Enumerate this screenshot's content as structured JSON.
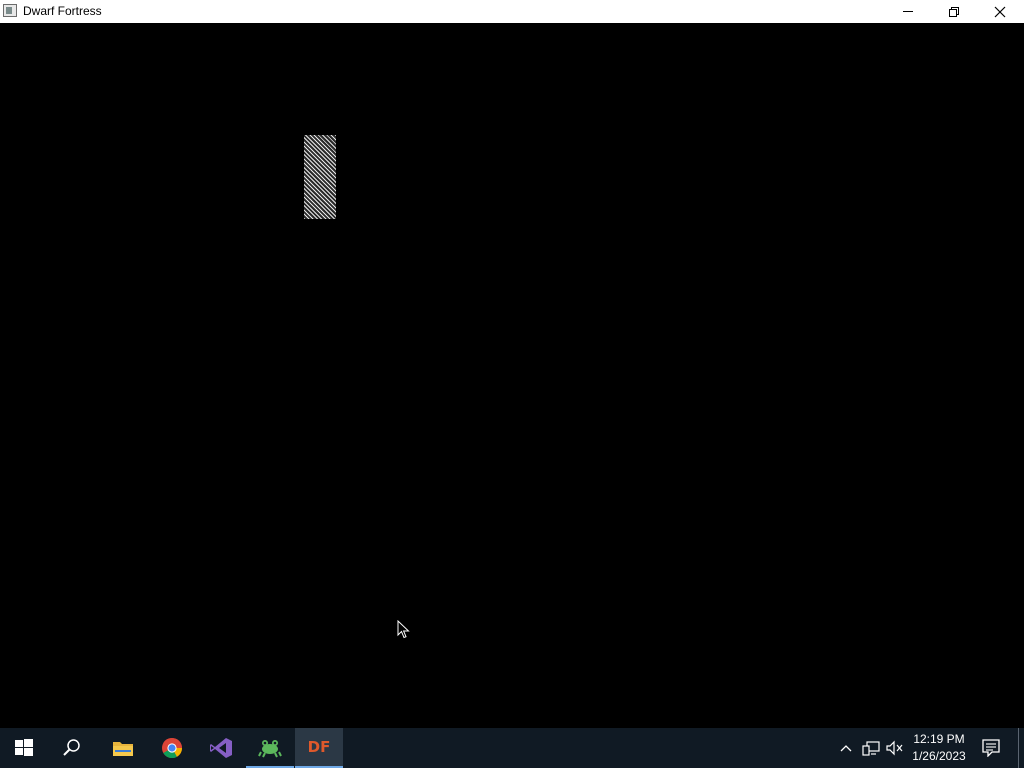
{
  "window": {
    "title": "Dwarf Fortress",
    "icon": "app-window-icon",
    "controls": [
      "minimize-icon",
      "restore-icon",
      "close-icon"
    ]
  },
  "taskbar": {
    "items": [
      {
        "name": "start",
        "icon": "windows-logo-icon"
      },
      {
        "name": "search",
        "icon": "search-icon"
      },
      {
        "name": "file-explorer",
        "icon": "folder-icon"
      },
      {
        "name": "chrome",
        "icon": "chrome-icon"
      },
      {
        "name": "visual-studio",
        "icon": "visual-studio-icon"
      },
      {
        "name": "app-frog",
        "icon": "frog-icon"
      },
      {
        "name": "dwarf-fortress",
        "label": "DF",
        "active": true
      }
    ],
    "tray": [
      "chevron-up-icon",
      "network-icon",
      "volume-muted-icon"
    ],
    "clock": {
      "time": "12:19 PM",
      "date": "1/26/2023"
    },
    "notification_icon": "notification-icon"
  },
  "colors": {
    "titlebar": "#ffffff",
    "game_bg": "#000000",
    "taskbar": "#101a24",
    "df_orange": "#e0592b",
    "active_underline": "#6ea8e6"
  }
}
